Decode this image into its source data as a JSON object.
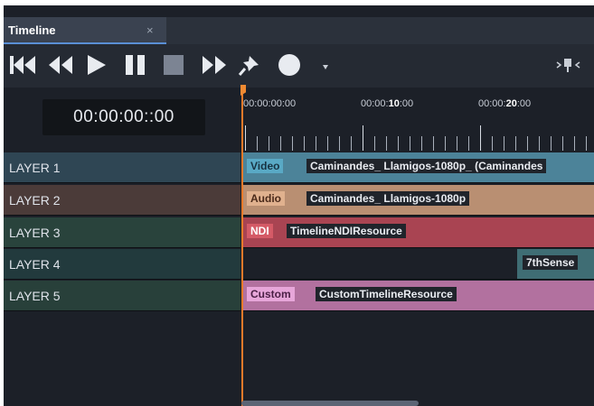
{
  "tab": {
    "title": "Timeline",
    "close": "×"
  },
  "toolbar": {
    "buttons": [
      "skip-to-start",
      "rewind",
      "play",
      "pause",
      "stop",
      "fast-forward",
      "pin",
      "record",
      "record-dropdown",
      "snap"
    ]
  },
  "timecode": "00:00:00::00",
  "ruler": {
    "labels": [
      {
        "prefix": "00:00:00:00",
        "bold": ""
      },
      {
        "prefix": "00:00:",
        "bold": "10",
        "suffix": ":00"
      },
      {
        "prefix": "00:00:",
        "bold": "20",
        "suffix": ":00"
      }
    ]
  },
  "layers": [
    {
      "name": "LAYER 1",
      "color": "#2f4654"
    },
    {
      "name": "LAYER 2",
      "color": "#4b3b39"
    },
    {
      "name": "LAYER 3",
      "color": "#29433c"
    },
    {
      "name": "LAYER 4",
      "color": "#223a3d"
    },
    {
      "name": "LAYER 5",
      "color": "#28403a"
    }
  ],
  "clips": [
    {
      "badge": "Video",
      "badge_bg": "#59a9c5",
      "badge_fg": "#183342",
      "name": "Caminandes_ Llamigos-1080p_ (Caminandes",
      "clip_bg": "#4c8399"
    },
    {
      "badge": "Audio",
      "badge_bg": "#e0b18e",
      "badge_fg": "#4a2a1a",
      "name": "Caminandes_ Llamigos-1080p",
      "clip_bg": "#b98f72"
    },
    {
      "badge": "NDI",
      "badge_bg": "#d45a66",
      "badge_fg": "#ffffff",
      "name": "TimelineNDIResource",
      "clip_bg": "#a94452"
    },
    {
      "badge": "",
      "name": "7thSense",
      "clip_bg": "#3f6d74"
    },
    {
      "badge": "Custom",
      "badge_bg": "#e7a6d9",
      "badge_fg": "#4a1f44",
      "name": "CustomTimelineResource",
      "clip_bg": "#b2719f"
    }
  ]
}
